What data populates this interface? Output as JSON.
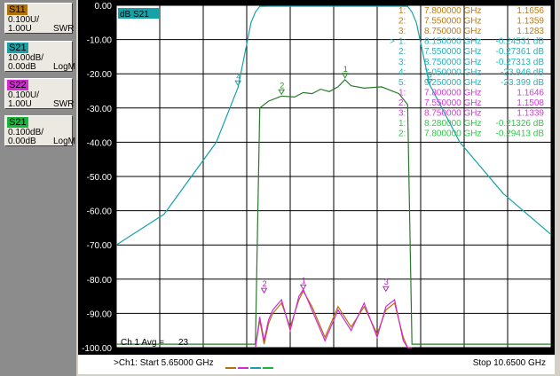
{
  "traces": [
    {
      "id": "S11",
      "color": "#b0720c",
      "scale": "0.100U/",
      "ref": "1.00U",
      "format": "SWR"
    },
    {
      "id": "S21",
      "color": "#16a2a8",
      "scale": "10.00dB/",
      "ref": "0.00dB",
      "format": "LogM"
    },
    {
      "id": "S22",
      "color": "#d42ad4",
      "scale": "0.100U/",
      "ref": "1.00U",
      "format": "SWR"
    },
    {
      "id": "S21",
      "color": "#16b83a",
      "scale": "0.100dB/",
      "ref": "0.00dB",
      "format": "LogM"
    }
  ],
  "active_trace_label": "dB S21",
  "averaging": {
    "label": "Ch 1 Avg =",
    "value": "23"
  },
  "sweep": {
    "start": ">Ch1: Start  5.65000 GHz",
    "stop": "Stop  10.6500 GHz"
  },
  "markers": [
    {
      "idx": "1:",
      "freq": "7.800000 GHz",
      "value": "1.1656",
      "color": "#c07a12",
      "active": ""
    },
    {
      "idx": "2:",
      "freq": "7.550000 GHz",
      "value": "1.1359",
      "color": "#c07a12",
      "active": ""
    },
    {
      "idx": "3:",
      "freq": "8.750000 GHz",
      "value": "1.1283",
      "color": "#c07a12",
      "active": ""
    },
    {
      "idx": "1:",
      "freq": "8.150000 GHz",
      "value": "-0.24531 dB",
      "color": "#22b5bd",
      "active": ">"
    },
    {
      "idx": "2:",
      "freq": "7.550000 GHz",
      "value": "-0.27361 dB",
      "color": "#22b5bd",
      "active": ""
    },
    {
      "idx": "3:",
      "freq": "8.750000 GHz",
      "value": "-0.27313 dB",
      "color": "#22b5bd",
      "active": ""
    },
    {
      "idx": "4:",
      "freq": "7.050000 GHz",
      "value": "-23.946 dB",
      "color": "#22b5bd",
      "active": ""
    },
    {
      "idx": "5:",
      "freq": "9.250000 GHz",
      "value": "-23.399 dB",
      "color": "#22b5bd",
      "active": ""
    },
    {
      "idx": "1:",
      "freq": "7.800000 GHz",
      "value": "1.1646",
      "color": "#d83ad8",
      "active": ""
    },
    {
      "idx": "2:",
      "freq": "7.550000 GHz",
      "value": "1.1508",
      "color": "#d83ad8",
      "active": ""
    },
    {
      "idx": "3:",
      "freq": "8.750000 GHz",
      "value": "1.1339",
      "color": "#d83ad8",
      "active": ""
    },
    {
      "idx": "1:",
      "freq": "8.280000 GHz",
      "value": "-0.21326 dB",
      "color": "#2fc84a",
      "active": ""
    },
    {
      "idx": "2:",
      "freq": "7.800000 GHz",
      "value": "-0.29413 dB",
      "color": "#2fc84a",
      "active": ""
    }
  ],
  "plot_marker_labels": [
    {
      "text": "1",
      "color": "#2a8a2a"
    },
    {
      "text": "2",
      "color": "#2a8a2a"
    },
    {
      "text": "4",
      "color": "#16a2a8"
    },
    {
      "text": "5",
      "color": "#16a2a8"
    },
    {
      "text": "1",
      "color": "#b02ab0"
    },
    {
      "text": "2",
      "color": "#b02ab0"
    },
    {
      "text": "3",
      "color": "#b02ab0"
    }
  ],
  "chart_data": {
    "type": "line",
    "x_range_ghz": [
      5.65,
      10.65
    ],
    "y_range": [
      -100,
      0
    ],
    "yticks": [
      "0.00",
      "-10.00",
      "-20.00",
      "-30.00",
      "-40.00",
      "-50.00",
      "-60.00",
      "-70.00",
      "-80.00",
      "-90.00",
      "-100.00"
    ],
    "grid": true,
    "series": [
      {
        "name": "S21",
        "color": "#16a2a8",
        "x": [
          5.65,
          6.2,
          6.8,
          7.05,
          7.2,
          7.25,
          7.3,
          7.4,
          8.15,
          8.9,
          9.0,
          9.05,
          9.1,
          9.25,
          9.6,
          10.1,
          10.65
        ],
        "y": [
          -70,
          -61,
          -40,
          -24,
          -5,
          -2,
          -0.3,
          -0.25,
          -0.25,
          -0.25,
          -0.3,
          -2,
          -5,
          -23,
          -40,
          -55,
          -67
        ]
      },
      {
        "name": "S21",
        "color": "#2a7a2a",
        "x": [
          5.65,
          7.25,
          7.3,
          7.4,
          7.55,
          7.7,
          7.8,
          7.9,
          8.0,
          8.1,
          8.2,
          8.28,
          8.35,
          8.5,
          8.7,
          8.9,
          9.0,
          9.05,
          10.65
        ],
        "y": [
          -99,
          -99,
          -30,
          -28,
          -26.5,
          -26.8,
          -25.5,
          -25.8,
          -24.5,
          -25.2,
          -23.8,
          -21.7,
          -23.5,
          -24.2,
          -23.8,
          -25.8,
          -29,
          -99,
          -99
        ]
      },
      {
        "name": "S11",
        "color": "#b0720c",
        "x": [
          7.25,
          7.3,
          7.35,
          7.4,
          7.45,
          7.55,
          7.65,
          7.75,
          7.8,
          7.9,
          8.05,
          8.2,
          8.35,
          8.5,
          8.65,
          8.75,
          8.85,
          8.95,
          9.0,
          9.05
        ],
        "y": [
          -100,
          -92,
          -99,
          -93,
          -90,
          -87,
          -94,
          -86,
          -83.5,
          -88,
          -97,
          -88,
          -94,
          -88,
          -96,
          -89,
          -87,
          -97,
          -100,
          -100
        ]
      },
      {
        "name": "S22",
        "color": "#d42ad4",
        "x": [
          7.25,
          7.3,
          7.35,
          7.4,
          7.45,
          7.55,
          7.65,
          7.75,
          7.8,
          7.9,
          8.05,
          8.2,
          8.35,
          8.5,
          8.65,
          8.75,
          8.85,
          8.95,
          9.0,
          9.05
        ],
        "y": [
          -100,
          -91,
          -98,
          -92,
          -89,
          -86,
          -95,
          -85,
          -83,
          -89,
          -98,
          -89,
          -95,
          -87,
          -97,
          -88,
          -86,
          -98,
          -100,
          -100
        ]
      }
    ]
  }
}
